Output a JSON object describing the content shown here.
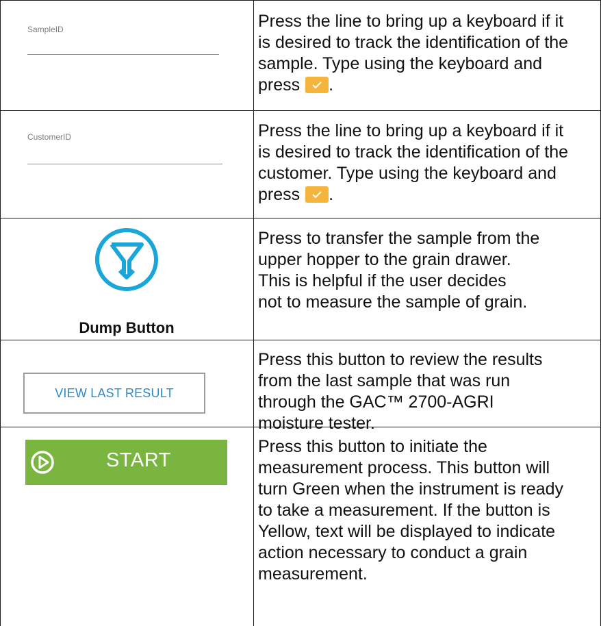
{
  "rows": [
    {
      "field_label": "SampleID",
      "description": "Press the line to bring up a keyboard if it\nis desired to track the identification of the\nsample. Type using the keyboard and\npress",
      "suffix": "."
    },
    {
      "field_label": "CustomerID",
      "description": "Press the line to bring up a keyboard if it\nis desired to track the identification of the\ncustomer. Type using the keyboard and\npress",
      "suffix": "."
    },
    {
      "caption": "Dump Button",
      "icon": "dump-funnel-icon",
      "description": "Press to transfer the sample from the\nupper hopper to the grain drawer.\nThis is helpful if the user decides\nnot to measure the sample of grain."
    },
    {
      "button_label": "VIEW LAST RESULT",
      "description": "Press this button to review the results\nfrom the last sample that was run\nthrough the GAC™ 2700-AGRI\nmoisture tester."
    },
    {
      "button_label": "START",
      "icon": "play-circle-icon",
      "description": "Press this button to initiate the\nmeasurement process. This button will\nturn Green when the instrument is ready\nto take a measurement. If the button is\nYellow, text will be displayed to indicate\naction necessary to conduct a grain\nmeasurement."
    }
  ],
  "colors": {
    "confirm_badge": "#f5b53d",
    "dump_icon": "#1aa6d8",
    "view_button_text": "#2b89c6",
    "start_button": "#7ab53f"
  }
}
